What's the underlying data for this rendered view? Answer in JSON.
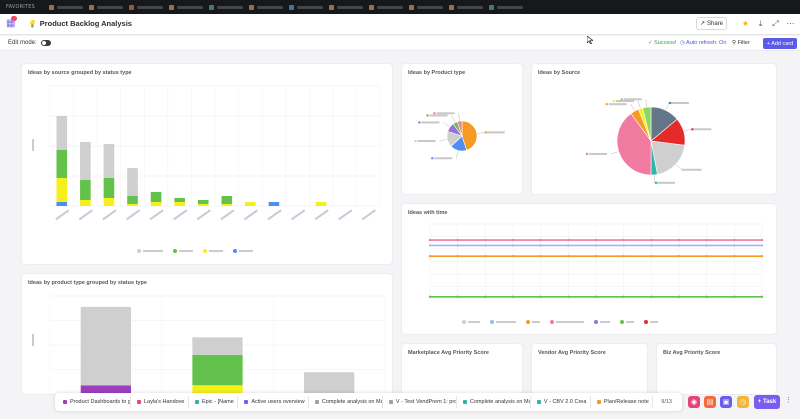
{
  "favorites": {
    "label": "FAVORITES",
    "items": [
      {
        "color": "#f2c94c"
      },
      {
        "color": "#f2c94c"
      },
      {
        "color": "#f2994a"
      },
      {
        "color": "#f2c94c"
      },
      {
        "color": "#6fcf97"
      },
      {
        "color": "#f2c94c"
      },
      {
        "color": "#56ccf2"
      },
      {
        "color": "#f2c94c"
      },
      {
        "color": "#f2c94c"
      },
      {
        "color": "#f2c94c"
      },
      {
        "color": "#f2c94c"
      },
      {
        "color": "#6fcf97"
      }
    ]
  },
  "header": {
    "title": "Product Backlog Analysis",
    "share_label": "Share"
  },
  "toolbar": {
    "edit_mode_label": "Edit mode:",
    "success_label": "Success!",
    "auto_refresh_label": "Auto refresh: On",
    "filter_label": "Filter",
    "add_card_label": "+ Add card"
  },
  "cards": {
    "source_status": "Ideas by source grouped by status type",
    "product_type": "Ideas by Product type",
    "by_source": "Ideas by Source",
    "over_time": "Ideas with time",
    "product_status": "Ideas by product type grouped by status type",
    "marketplace_priority": "Marketplace Avg Priority Score",
    "vendor_priority": "Vendor Avg Priority Score",
    "biz_priority": "Biz Avg Priority Score"
  },
  "colors": {
    "gray": "#cfcfcf",
    "green": "#63c24b",
    "yellow": "#f7ef1a",
    "blue": "#4d8ef0",
    "orange": "#f59a23",
    "pink": "#f07aa0",
    "red": "#e52a2a",
    "slate": "#647687",
    "teal": "#2cb5a8",
    "purple": "#9b6fdc"
  },
  "chart_data": [
    {
      "type": "bar",
      "stacked": true,
      "categories_count": 14,
      "series": [
        {
          "color": "#4d8ef0",
          "values": [
            2,
            0,
            0,
            0,
            0,
            0,
            0,
            0,
            0,
            2,
            0,
            0,
            0,
            0
          ]
        },
        {
          "color": "#f7ef1a",
          "values": [
            12,
            3,
            4,
            1,
            2,
            2,
            1,
            1,
            2,
            0,
            0,
            2,
            0,
            0
          ]
        },
        {
          "color": "#63c24b",
          "values": [
            14,
            10,
            10,
            4,
            5,
            2,
            2,
            4,
            0,
            0,
            0,
            0,
            0,
            0
          ]
        },
        {
          "color": "#cfcfcf",
          "values": [
            17,
            19,
            17,
            14,
            0,
            0,
            0,
            0,
            0,
            0,
            0,
            0,
            0,
            0
          ]
        }
      ],
      "ylim": [
        0,
        60
      ],
      "grid": true,
      "legend": "bottom"
    },
    {
      "type": "pie",
      "slices": [
        {
          "color": "#f59a23",
          "value": 45
        },
        {
          "color": "#4d8ef0",
          "value": 18
        },
        {
          "color": "#cfcfcf",
          "value": 17
        },
        {
          "color": "#9b6fdc",
          "value": 10
        },
        {
          "color": "#63c24b",
          "value": 5
        },
        {
          "color": "#f07aa0",
          "value": 5
        }
      ]
    },
    {
      "type": "pie",
      "slices": [
        {
          "color": "#647687",
          "value": 14
        },
        {
          "color": "#e52a2a",
          "value": 13
        },
        {
          "color": "#cfcfcf",
          "value": 20
        },
        {
          "color": "#2cb5a8",
          "value": 3
        },
        {
          "color": "#f07aa0",
          "value": 40
        },
        {
          "color": "#f59a23",
          "value": 4
        },
        {
          "color": "#f7ef1a",
          "value": 2
        },
        {
          "color": "#8fd66a",
          "value": 4
        }
      ]
    },
    {
      "type": "line",
      "series": [
        {
          "color": "#f07aa0",
          "values": [
            55,
            55,
            55,
            55,
            55,
            55,
            55,
            55,
            55,
            55,
            55,
            55,
            55
          ]
        },
        {
          "color": "#9db8f5",
          "values": [
            50,
            50,
            50,
            50,
            50,
            50,
            50,
            50,
            50,
            50,
            50,
            50,
            50
          ]
        },
        {
          "color": "#f59a23",
          "values": [
            40,
            40,
            40,
            40,
            40,
            40,
            40,
            40,
            40,
            40,
            40,
            40,
            40
          ]
        },
        {
          "color": "#63c24b",
          "values": [
            2,
            2,
            2,
            2,
            2,
            2,
            2,
            2,
            2,
            2,
            2,
            2,
            2
          ]
        }
      ],
      "ylim": [
        0,
        70
      ],
      "grid": true,
      "legend": "bottom"
    },
    {
      "type": "bar",
      "stacked": true,
      "categories_count": 3,
      "series": [
        {
          "color": "#9b3fbf",
          "values": [
            4,
            0,
            0
          ]
        },
        {
          "color": "#f7ef1a",
          "values": [
            0,
            4,
            0
          ]
        },
        {
          "color": "#63c24b",
          "values": [
            0,
            14,
            0
          ]
        },
        {
          "color": "#cfcfcf",
          "values": [
            36,
            8,
            10
          ]
        }
      ],
      "ylim": [
        0,
        45
      ],
      "grid": true
    }
  ],
  "tray": {
    "tabs": [
      {
        "label": "Product Dashboards to g",
        "color": "#9b3fbf"
      },
      {
        "label": "Layla's Handove",
        "color": "#e44b6f"
      },
      {
        "label": "Epic - [Name",
        "color": "#2cb5a8"
      },
      {
        "label": "Active users overview",
        "color": "#7b5cf0"
      },
      {
        "label": "Complete analysis on Ma",
        "color": "#9aa0a6"
      },
      {
        "label": "V - Test VendPrem 1: pro",
        "color": "#9aa0a6"
      },
      {
        "label": "Complete analysis on Ma",
        "color": "#2cb5a8"
      },
      {
        "label": "V - CBV 2.0 Crea",
        "color": "#2cb5a8"
      },
      {
        "label": "Plan/Release note",
        "color": "#f59a23"
      }
    ],
    "count": "9/13",
    "task_label": "+ Task"
  }
}
